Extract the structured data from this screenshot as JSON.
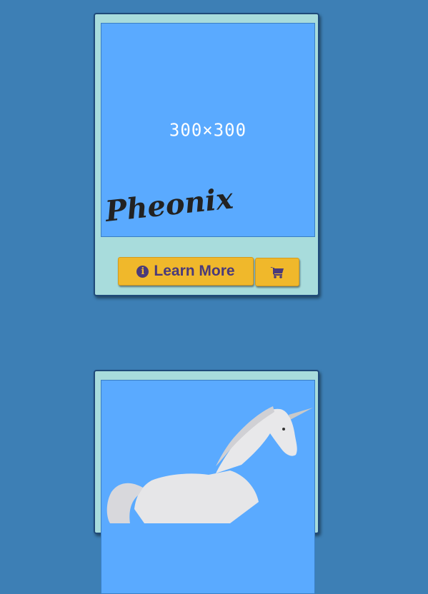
{
  "cards": [
    {
      "placeholder": "300×300",
      "product_name": "Pheonix",
      "learn_more_label": "Learn More",
      "info_icon_glyph": "i",
      "cart_icon": "shopping-cart-icon"
    },
    {
      "image_subject": "unicorn"
    }
  ],
  "colors": {
    "page_bg": "#3d7fb5",
    "card_bg": "#a8dcdc",
    "card_border": "#1f4a7a",
    "image_bg": "#5aaaff",
    "button_bg": "#f0b82b",
    "button_text": "#4a3a7a"
  }
}
